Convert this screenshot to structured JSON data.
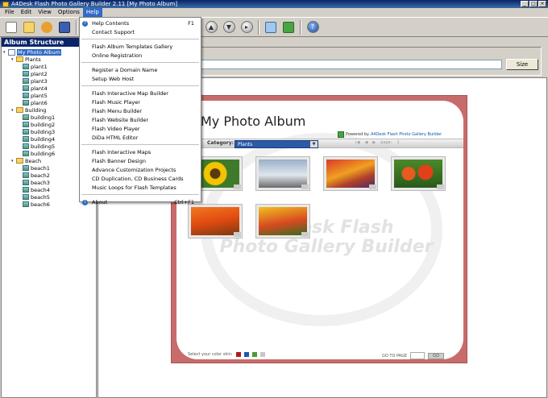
{
  "window": {
    "title": "A4Desk Flash Photo Gallery Builder  2.11  [My Photo Album]"
  },
  "menubar": [
    "File",
    "Edit",
    "View",
    "Options",
    "Help"
  ],
  "help_menu": {
    "items": [
      {
        "label": "Help Contents",
        "shortcut": "F1",
        "icon": "help-icon"
      },
      {
        "label": "Contact Support"
      },
      "sep",
      {
        "label": "Flash Album Templates Gallery"
      },
      {
        "label": "Online Registration"
      },
      "sep",
      {
        "label": "Register a Domain Name"
      },
      {
        "label": "Setup Web Host"
      },
      "sep",
      {
        "label": "Flash Interactive Map Builder"
      },
      {
        "label": "Flash Music Player"
      },
      {
        "label": "Flash Menu Builder"
      },
      {
        "label": "Flash Website Builder"
      },
      {
        "label": "Flash Video Player"
      },
      {
        "label": "DiDa HTML Editor"
      },
      "sep",
      {
        "label": "Flash Interactive Maps"
      },
      {
        "label": "Flash Banner Design"
      },
      {
        "label": "Advance Customization Projects"
      },
      {
        "label": "CD Duplication, CD Business Cards"
      },
      {
        "label": "Music Loops for Flash Templates"
      },
      "sep",
      {
        "label": "About",
        "shortcut": "Ctrl+F1",
        "icon": "info-icon"
      }
    ]
  },
  "sidebar": {
    "header": "Album Structure",
    "root": "My Photo Album",
    "folders": [
      {
        "name": "Plants",
        "items": [
          "plant1",
          "plant2",
          "plant3",
          "plant4",
          "plant5",
          "plant6"
        ]
      },
      {
        "name": "Building",
        "items": [
          "building1",
          "building2",
          "building3",
          "building4",
          "building5",
          "building6"
        ]
      },
      {
        "name": "Beach",
        "items": [
          "beach1",
          "beach2",
          "beach3",
          "beach4",
          "beach5",
          "beach6"
        ]
      }
    ]
  },
  "main": {
    "size_button": "Size"
  },
  "gallery": {
    "title": "My Photo Album",
    "powered_by": "Powered by",
    "brand": "A4Desk Flash Photo Gallery Builder",
    "category_label": "Category:",
    "category_value": "Plants",
    "page_label": "page:",
    "page_value": "1",
    "watermark_line1": "A4Desk Flash",
    "watermark_line2": "Photo Gallery Builder",
    "color_skin_label": "Select your color skin:",
    "goto_label": "GO TO PAGE",
    "go_button": "GO",
    "swatches": [
      "#b01c1c",
      "#1c5aa8",
      "#4a9a3a",
      "#c8c8c8"
    ]
  }
}
